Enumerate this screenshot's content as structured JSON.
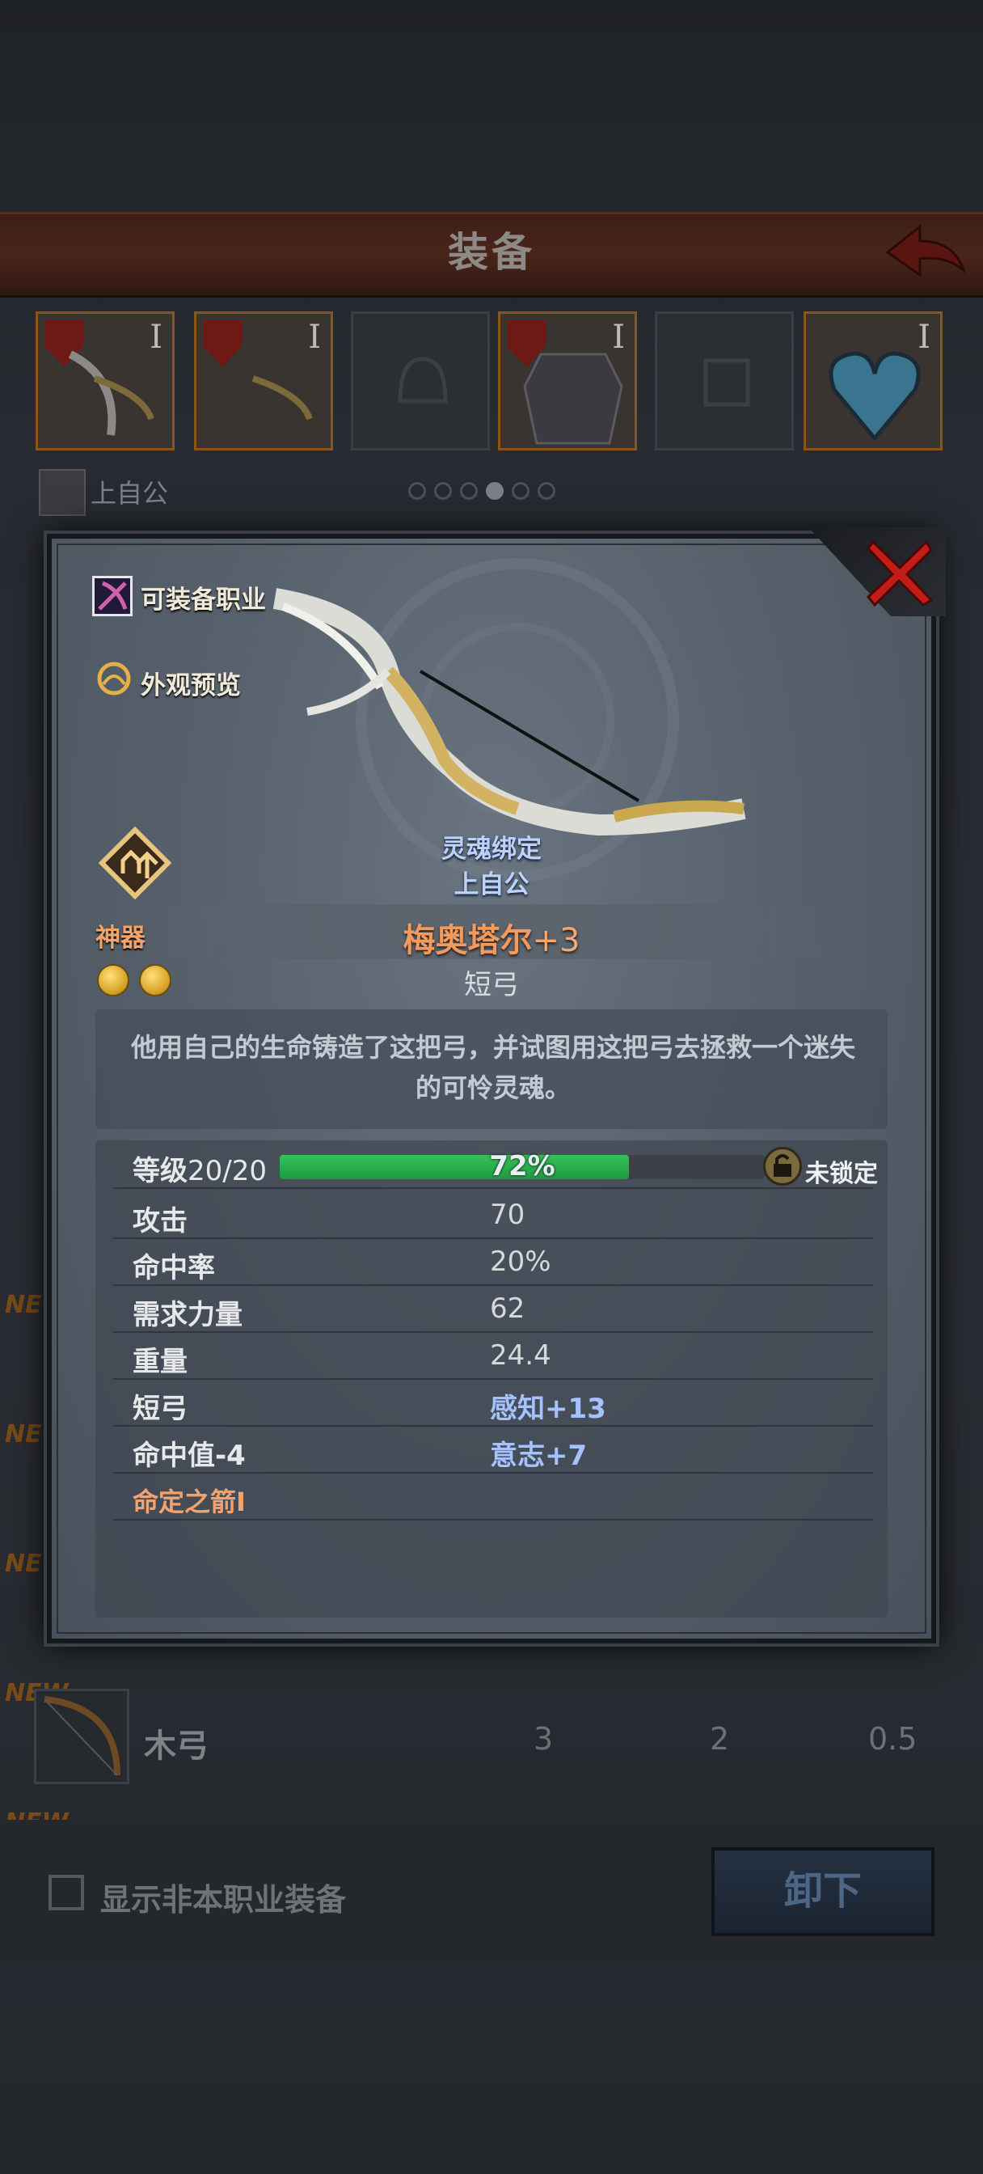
{
  "screen": {
    "title": "装备",
    "character_name": "上自公",
    "slots": [
      {
        "roman": "I",
        "equipped": true
      },
      {
        "roman": "I",
        "equipped": true
      },
      {
        "roman": "",
        "equipped": false
      },
      {
        "roman": "I",
        "equipped": true
      },
      {
        "roman": "",
        "equipped": false
      },
      {
        "roman": "I",
        "equipped": true
      }
    ],
    "page_dots": {
      "count": 6,
      "active": 3
    },
    "new_tag": "NEW",
    "list_item": {
      "name": "木弓",
      "values": [
        "3",
        "2",
        "0.5"
      ]
    },
    "show_other_class_label": "显示非本职业装备",
    "unequip_label": "卸下"
  },
  "modal": {
    "equip_class_label": "可装备职业",
    "appearance_preview_label": "外观预览",
    "soul_bound_label": "灵魂绑定",
    "owner_name": "上自公",
    "rarity_label": "神器",
    "item_name": "梅奥塔尔",
    "item_plus": "+3",
    "item_type": "短弓",
    "description": "他用自己的生命铸造了这把弓，并试图用这把弓去拯救一个迷失的可怜灵魂。",
    "level_label": "等级",
    "level_value": "20/20",
    "exp_percent_text": "72%",
    "exp_fraction": 0.72,
    "lock_label": "未锁定",
    "stats": [
      {
        "label": "攻击",
        "value": "70"
      },
      {
        "label": "命中率",
        "value": "20%"
      },
      {
        "label": "需求力量",
        "value": "62"
      },
      {
        "label": "重量",
        "value": "24.4"
      }
    ],
    "bonus_rows": [
      {
        "left": "短弓",
        "right": "感知+13"
      },
      {
        "left": "命中值-4",
        "right": "意志+7"
      }
    ],
    "skill": "命定之箭I"
  },
  "colors": {
    "rarity_orange": "#f59a5a",
    "bind_blue": "#b9d2ff",
    "exp_green": "#2fb653"
  }
}
